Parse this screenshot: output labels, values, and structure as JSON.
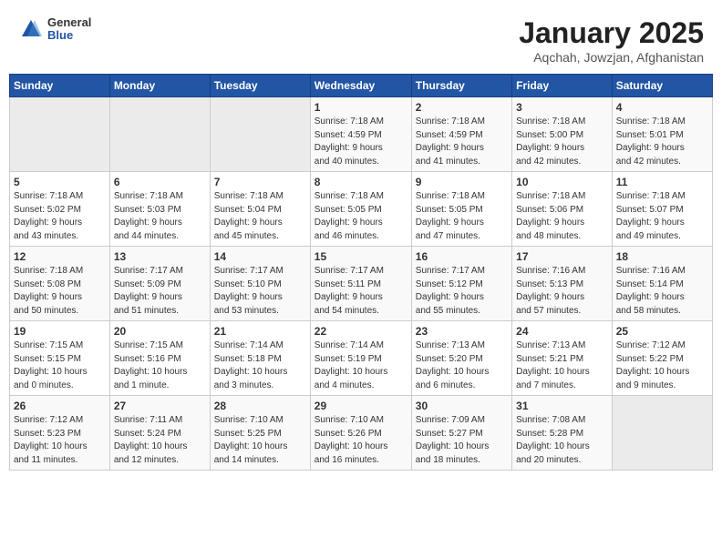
{
  "logo": {
    "general": "General",
    "blue": "Blue"
  },
  "title": {
    "month": "January 2025",
    "location": "Aqchah, Jowzjan, Afghanistan"
  },
  "weekdays": [
    "Sunday",
    "Monday",
    "Tuesday",
    "Wednesday",
    "Thursday",
    "Friday",
    "Saturday"
  ],
  "weeks": [
    [
      {
        "day": "",
        "info": ""
      },
      {
        "day": "",
        "info": ""
      },
      {
        "day": "",
        "info": ""
      },
      {
        "day": "1",
        "info": "Sunrise: 7:18 AM\nSunset: 4:59 PM\nDaylight: 9 hours\nand 40 minutes."
      },
      {
        "day": "2",
        "info": "Sunrise: 7:18 AM\nSunset: 4:59 PM\nDaylight: 9 hours\nand 41 minutes."
      },
      {
        "day": "3",
        "info": "Sunrise: 7:18 AM\nSunset: 5:00 PM\nDaylight: 9 hours\nand 42 minutes."
      },
      {
        "day": "4",
        "info": "Sunrise: 7:18 AM\nSunset: 5:01 PM\nDaylight: 9 hours\nand 42 minutes."
      }
    ],
    [
      {
        "day": "5",
        "info": "Sunrise: 7:18 AM\nSunset: 5:02 PM\nDaylight: 9 hours\nand 43 minutes."
      },
      {
        "day": "6",
        "info": "Sunrise: 7:18 AM\nSunset: 5:03 PM\nDaylight: 9 hours\nand 44 minutes."
      },
      {
        "day": "7",
        "info": "Sunrise: 7:18 AM\nSunset: 5:04 PM\nDaylight: 9 hours\nand 45 minutes."
      },
      {
        "day": "8",
        "info": "Sunrise: 7:18 AM\nSunset: 5:05 PM\nDaylight: 9 hours\nand 46 minutes."
      },
      {
        "day": "9",
        "info": "Sunrise: 7:18 AM\nSunset: 5:05 PM\nDaylight: 9 hours\nand 47 minutes."
      },
      {
        "day": "10",
        "info": "Sunrise: 7:18 AM\nSunset: 5:06 PM\nDaylight: 9 hours\nand 48 minutes."
      },
      {
        "day": "11",
        "info": "Sunrise: 7:18 AM\nSunset: 5:07 PM\nDaylight: 9 hours\nand 49 minutes."
      }
    ],
    [
      {
        "day": "12",
        "info": "Sunrise: 7:18 AM\nSunset: 5:08 PM\nDaylight: 9 hours\nand 50 minutes."
      },
      {
        "day": "13",
        "info": "Sunrise: 7:17 AM\nSunset: 5:09 PM\nDaylight: 9 hours\nand 51 minutes."
      },
      {
        "day": "14",
        "info": "Sunrise: 7:17 AM\nSunset: 5:10 PM\nDaylight: 9 hours\nand 53 minutes."
      },
      {
        "day": "15",
        "info": "Sunrise: 7:17 AM\nSunset: 5:11 PM\nDaylight: 9 hours\nand 54 minutes."
      },
      {
        "day": "16",
        "info": "Sunrise: 7:17 AM\nSunset: 5:12 PM\nDaylight: 9 hours\nand 55 minutes."
      },
      {
        "day": "17",
        "info": "Sunrise: 7:16 AM\nSunset: 5:13 PM\nDaylight: 9 hours\nand 57 minutes."
      },
      {
        "day": "18",
        "info": "Sunrise: 7:16 AM\nSunset: 5:14 PM\nDaylight: 9 hours\nand 58 minutes."
      }
    ],
    [
      {
        "day": "19",
        "info": "Sunrise: 7:15 AM\nSunset: 5:15 PM\nDaylight: 10 hours\nand 0 minutes."
      },
      {
        "day": "20",
        "info": "Sunrise: 7:15 AM\nSunset: 5:16 PM\nDaylight: 10 hours\nand 1 minute."
      },
      {
        "day": "21",
        "info": "Sunrise: 7:14 AM\nSunset: 5:18 PM\nDaylight: 10 hours\nand 3 minutes."
      },
      {
        "day": "22",
        "info": "Sunrise: 7:14 AM\nSunset: 5:19 PM\nDaylight: 10 hours\nand 4 minutes."
      },
      {
        "day": "23",
        "info": "Sunrise: 7:13 AM\nSunset: 5:20 PM\nDaylight: 10 hours\nand 6 minutes."
      },
      {
        "day": "24",
        "info": "Sunrise: 7:13 AM\nSunset: 5:21 PM\nDaylight: 10 hours\nand 7 minutes."
      },
      {
        "day": "25",
        "info": "Sunrise: 7:12 AM\nSunset: 5:22 PM\nDaylight: 10 hours\nand 9 minutes."
      }
    ],
    [
      {
        "day": "26",
        "info": "Sunrise: 7:12 AM\nSunset: 5:23 PM\nDaylight: 10 hours\nand 11 minutes."
      },
      {
        "day": "27",
        "info": "Sunrise: 7:11 AM\nSunset: 5:24 PM\nDaylight: 10 hours\nand 12 minutes."
      },
      {
        "day": "28",
        "info": "Sunrise: 7:10 AM\nSunset: 5:25 PM\nDaylight: 10 hours\nand 14 minutes."
      },
      {
        "day": "29",
        "info": "Sunrise: 7:10 AM\nSunset: 5:26 PM\nDaylight: 10 hours\nand 16 minutes."
      },
      {
        "day": "30",
        "info": "Sunrise: 7:09 AM\nSunset: 5:27 PM\nDaylight: 10 hours\nand 18 minutes."
      },
      {
        "day": "31",
        "info": "Sunrise: 7:08 AM\nSunset: 5:28 PM\nDaylight: 10 hours\nand 20 minutes."
      },
      {
        "day": "",
        "info": ""
      }
    ]
  ]
}
